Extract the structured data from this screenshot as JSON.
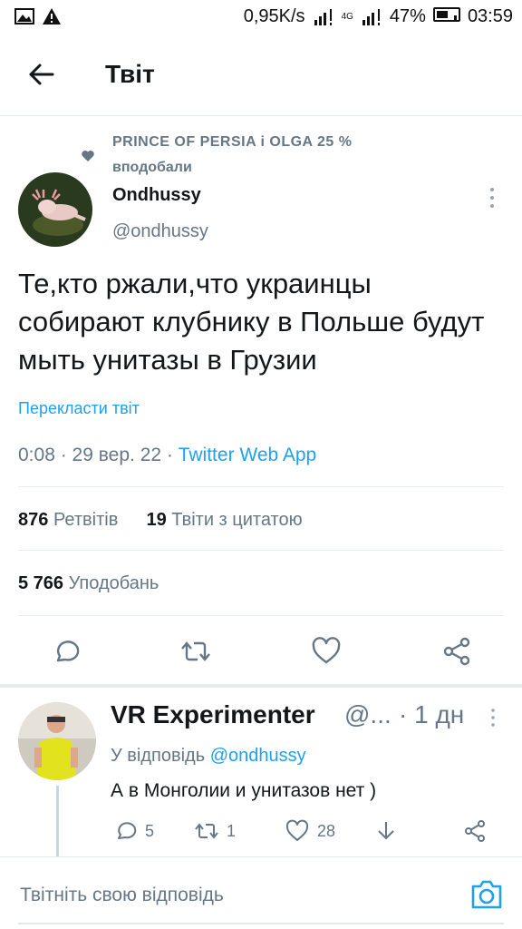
{
  "status_bar": {
    "network_speed": "0,95K/s",
    "network_type": "4G",
    "battery": "47%",
    "time": "03:59",
    "icons": [
      "gallery-icon",
      "warning-icon",
      "signal-icon",
      "battery-icon"
    ]
  },
  "header": {
    "title": "Твіт"
  },
  "liked_by": {
    "names": "PRINCE OF PERSIA і OLGA 25 %",
    "suffix": "вподобали"
  },
  "tweet": {
    "author_name": "Ondhussy",
    "author_handle": "@ondhussy",
    "text": "Те,кто ржали,что украинцы собирают клубнику в Польше будут мыть унитазы в Грузии",
    "translate_label": "Перекласти твіт",
    "time": "0:08",
    "date": "29 вер. 22",
    "source": "Twitter Web App",
    "retweets_count": "876",
    "retweets_label": "Ретвітів",
    "quotes_count": "19",
    "quotes_label": "Твіти з цитатою",
    "likes_count": "5 766",
    "likes_label": "Уподобань"
  },
  "reply": {
    "author_name": "VR Experimenter",
    "author_handle": "@...",
    "time": "1 дн",
    "replying_to_label": "У відповідь",
    "replying_to_handle": "@ondhussy",
    "text": "А в Монголии и унитазов нет )",
    "reply_count": "5",
    "retweet_count": "1",
    "like_count": "28"
  },
  "compose": {
    "placeholder": "Твітніть свою відповідь"
  },
  "colors": {
    "accent": "#1da1f2",
    "secondary_text": "#657786",
    "primary_text": "#14171a",
    "divider": "#e6ecf0"
  }
}
